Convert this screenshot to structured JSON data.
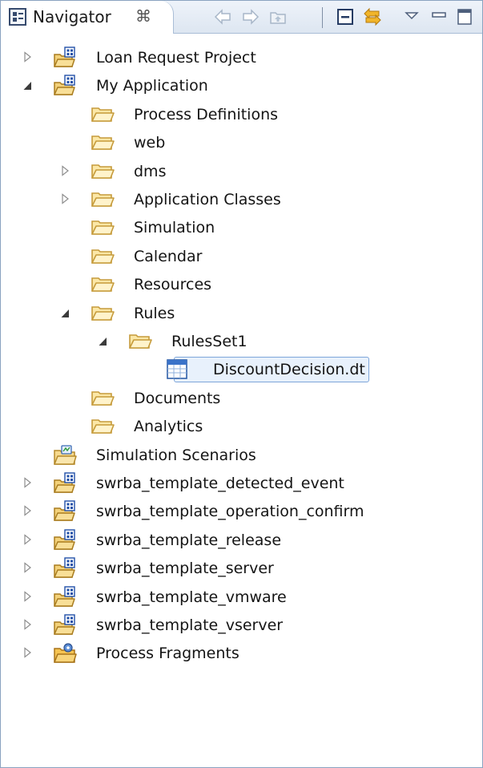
{
  "view": {
    "tab_label": "Navigator",
    "close_glyph": "⌘",
    "toolbar": [
      "back-arrow-icon",
      "forward-arrow-icon",
      "go-up-icon",
      "collapse-all-icon",
      "link-with-editor-icon",
      "view-menu-icon",
      "minimize-icon",
      "maximize-icon"
    ]
  },
  "tree": [
    {
      "label": "Loan Request Project",
      "icon": "project-folder-icon",
      "toggle": "collapsed"
    },
    {
      "label": "My Application",
      "icon": "project-folder-icon",
      "toggle": "expanded"
    },
    {
      "label": "Process Definitions",
      "icon": "folder-icon",
      "toggle": "none"
    },
    {
      "label": "web",
      "icon": "folder-icon",
      "toggle": "none"
    },
    {
      "label": "dms",
      "icon": "folder-icon",
      "toggle": "collapsed"
    },
    {
      "label": "Application Classes",
      "icon": "folder-icon",
      "toggle": "collapsed"
    },
    {
      "label": "Simulation",
      "icon": "folder-icon",
      "toggle": "none"
    },
    {
      "label": "Calendar",
      "icon": "folder-icon",
      "toggle": "none"
    },
    {
      "label": "Resources",
      "icon": "folder-icon",
      "toggle": "none"
    },
    {
      "label": "Rules",
      "icon": "folder-icon",
      "toggle": "expanded"
    },
    {
      "label": "RulesSet1",
      "icon": "folder-icon",
      "toggle": "expanded"
    },
    {
      "label": "DiscountDecision.dt",
      "icon": "decision-table-icon",
      "toggle": "none",
      "selected": true
    },
    {
      "label": "Documents",
      "icon": "folder-icon",
      "toggle": "none"
    },
    {
      "label": "Analytics",
      "icon": "folder-icon",
      "toggle": "none"
    },
    {
      "label": "Simulation Scenarios",
      "icon": "simulation-scenarios-icon",
      "toggle": "none"
    },
    {
      "label": "swrba_template_detected_event",
      "icon": "project-folder-icon",
      "toggle": "collapsed"
    },
    {
      "label": "swrba_template_operation_confirm",
      "icon": "project-folder-icon",
      "toggle": "collapsed"
    },
    {
      "label": "swrba_template_release",
      "icon": "project-folder-icon",
      "toggle": "collapsed"
    },
    {
      "label": "swrba_template_server",
      "icon": "project-folder-icon",
      "toggle": "collapsed"
    },
    {
      "label": "swrba_template_vmware",
      "icon": "project-folder-icon",
      "toggle": "collapsed"
    },
    {
      "label": "swrba_template_vserver",
      "icon": "project-folder-icon",
      "toggle": "collapsed"
    },
    {
      "label": "Process Fragments",
      "icon": "process-fragments-icon",
      "toggle": "collapsed"
    }
  ]
}
